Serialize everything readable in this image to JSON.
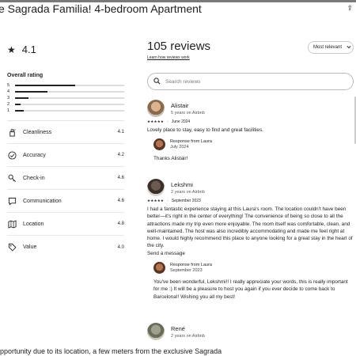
{
  "page": {
    "title": "e Sagrada Familia! 4-bedroom Apartment",
    "bottom_text": "pportunity due to its location, a few meters from the exclusive Sagrada"
  },
  "summary": {
    "rating": "4.1",
    "overall_label": "Overall rating",
    "distribution": [
      {
        "stars": "5",
        "fraction": 0.55
      },
      {
        "stars": "4",
        "fraction": 0.3
      },
      {
        "stars": "3",
        "fraction": 0.12
      },
      {
        "stars": "2",
        "fraction": 0.05
      },
      {
        "stars": "1",
        "fraction": 0.08
      }
    ],
    "categories": [
      {
        "label": "Cleanliness",
        "value": "4.1",
        "icon": "spray-icon"
      },
      {
        "label": "Accuracy",
        "value": "4.2",
        "icon": "check-circle-icon"
      },
      {
        "label": "Check-in",
        "value": "4.6",
        "icon": "key-icon"
      },
      {
        "label": "Communication",
        "value": "4.6",
        "icon": "chat-icon"
      },
      {
        "label": "Location",
        "value": "4.8",
        "icon": "map-icon"
      },
      {
        "label": "Value",
        "value": "4.0",
        "icon": "tag-icon"
      }
    ]
  },
  "reviews_header": {
    "title": "105 reviews",
    "learn_link": "Learn how reviews work",
    "sort_label": "Most relevant",
    "search_placeholder": "Search reviews"
  },
  "reviews": [
    {
      "name": "Alistair",
      "sub": "5 years on Airbnb",
      "stars": "★★★★★",
      "date": "June 2024",
      "text": "Lovely place to stay, easy to find and great facilities.",
      "response": {
        "label": "Response from Laura",
        "date": "July 2024",
        "text": "Thanks Alistair!"
      }
    },
    {
      "name": "Lekshmi",
      "sub": "2 years on Airbnb",
      "stars": "★★★★★",
      "date": "September 2023",
      "text": "I had a fantastic experience staying at this Laura's room. The location couldn't have been better—it's right in the center of everything! The convenience of being so close to all the attractions made my trip even more enjoyable. The room itself was comfortable, clean, and well-maintained. The host was also incredibly accommodating and made me feel right at home. I would highly recommend this place to anyone looking for a great stay in the heart of the city.",
      "extra": "Send a message",
      "response": {
        "label": "Response from Laura",
        "date": "September 2023",
        "text": "You've been wonderful, Lekshmi!! I really appreciate your words, this is really important for me :) It will be a pleasure to host you again if you ever decide to come back to Barcelona!! Wishing you all my best!"
      }
    },
    {
      "name": "René",
      "sub": "2 years on Airbnb"
    }
  ]
}
